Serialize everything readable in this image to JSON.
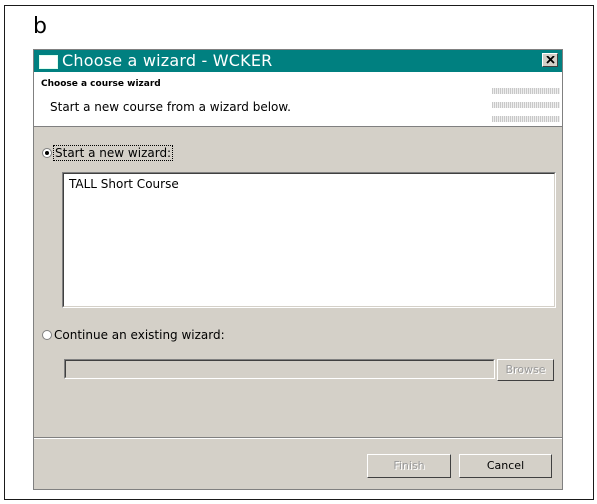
{
  "figure": {
    "panel_letter": "b"
  },
  "window": {
    "title": "Choose a wizard - WCKER",
    "close_symbol": "×",
    "accent_color": "#008080"
  },
  "header": {
    "title": "Choose a course wizard",
    "description": "Start a new course from a wizard below."
  },
  "options": {
    "start_new": {
      "label": "Start a new wizard:",
      "selected": true
    },
    "continue_existing": {
      "label": "Continue an existing wizard:",
      "selected": false
    }
  },
  "wizard_list": {
    "items": [
      "TALL Short Course"
    ]
  },
  "existing_path": {
    "value": ""
  },
  "buttons": {
    "browse": "Browse",
    "finish": "Finish",
    "cancel": "Cancel"
  },
  "icons": {
    "window_icon": "window-icon",
    "close_icon": "close-icon"
  }
}
